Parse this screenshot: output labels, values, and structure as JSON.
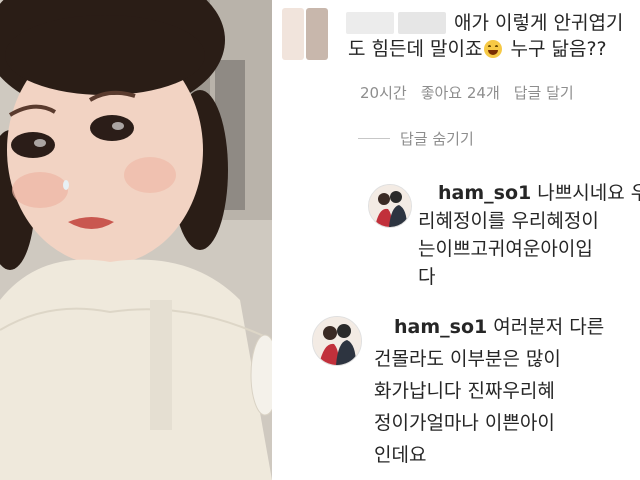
{
  "photo": {
    "description_icon": "child-photo-icon"
  },
  "top_comment": {
    "text_line1": "애가 이렇게 안귀엽기",
    "text_line2a": "도 힘든데 말이죠",
    "text_line2b": " 누구 닮음??",
    "time": "20시간",
    "likes": "좋아요 24개",
    "reply_action": "답글 달기",
    "hide_replies": "답글 숨기기"
  },
  "replies": [
    {
      "username": "ham_so1",
      "lines": [
        "나쁘시네요 우",
        "리혜정이를 우리혜정이",
        "는이쁘고귀여운아이입",
        "다"
      ]
    },
    {
      "username": "ham_so1",
      "lines": [
        "여러분저 다른",
        "건몰라도 이부분은 많이",
        "화가납니다 진짜우리혜",
        "정이가얼마나 이쁜아이",
        "인데요"
      ]
    }
  ],
  "colors": {
    "text": "#262626",
    "meta": "#8e8e8e"
  }
}
